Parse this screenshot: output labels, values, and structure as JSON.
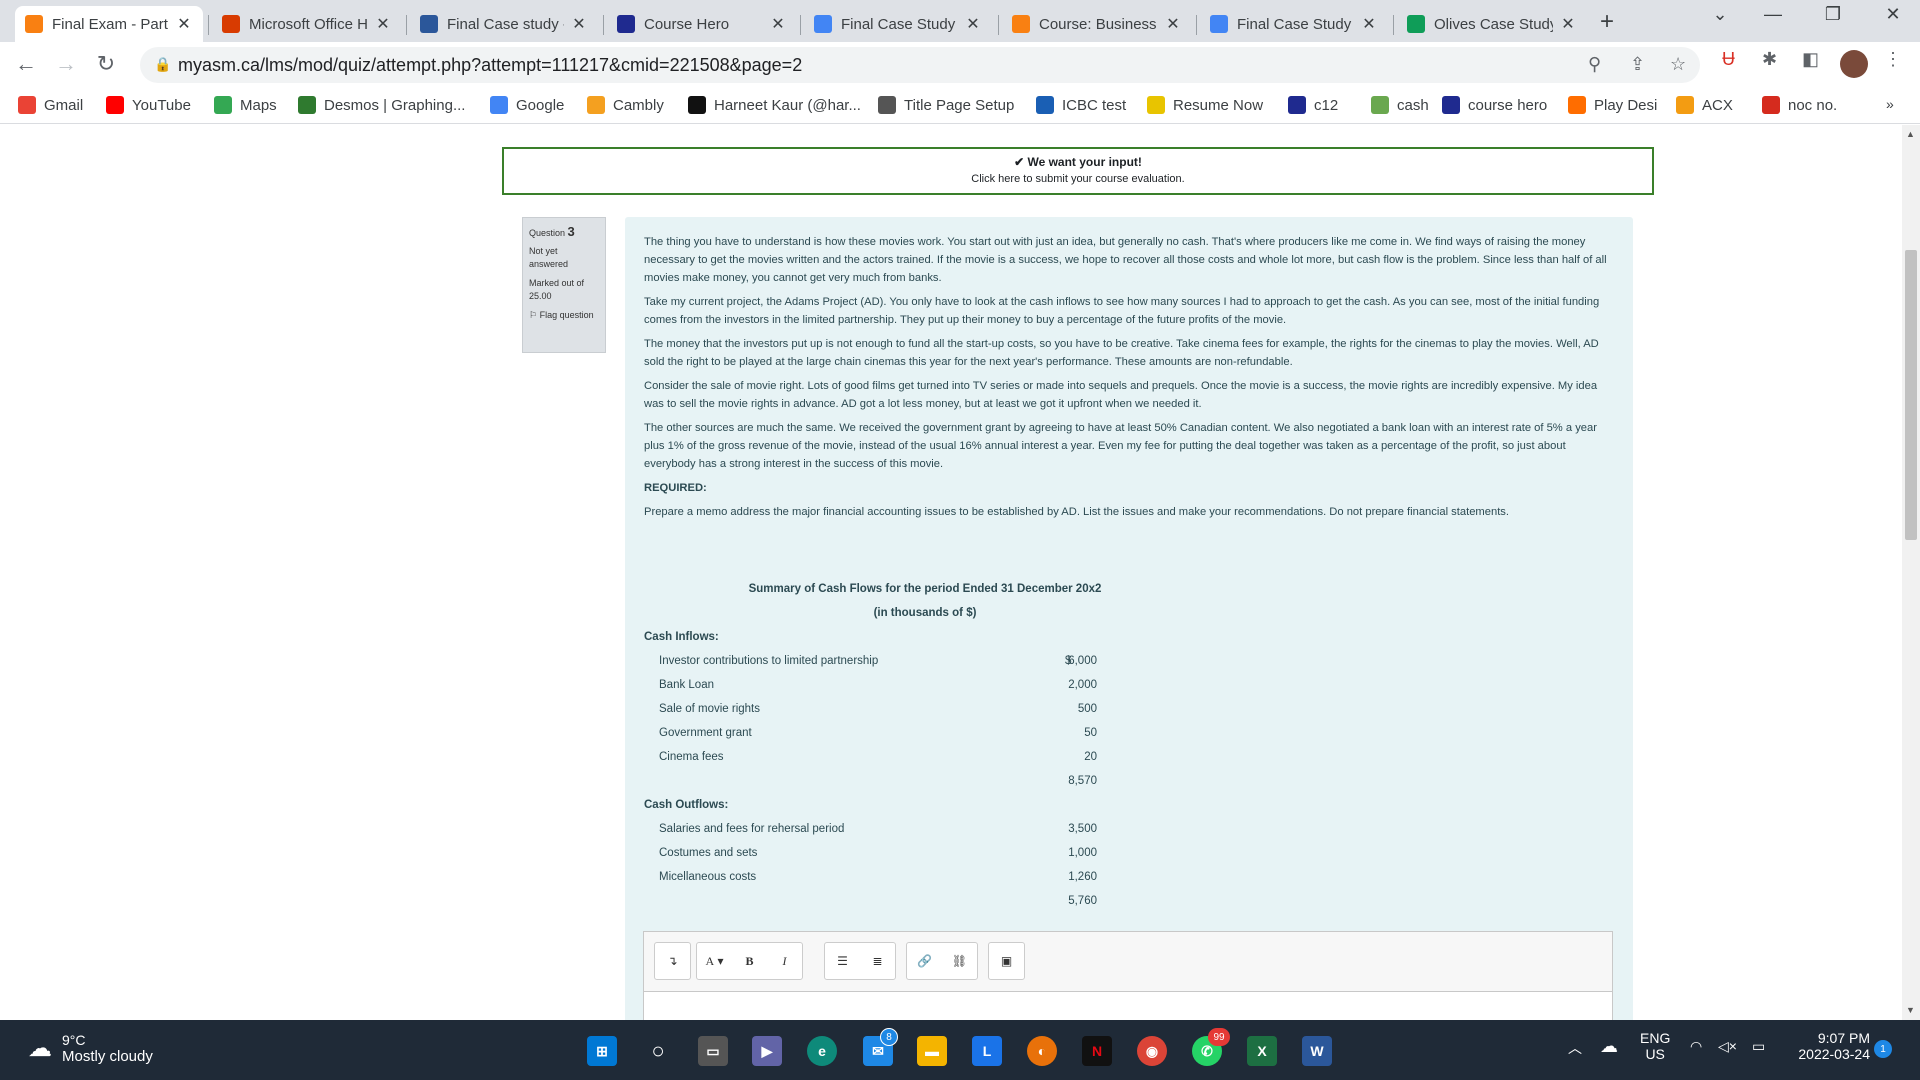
{
  "browser": {
    "tabs": [
      {
        "label": "Final Exam - Part",
        "icon": "moodle-icon",
        "color": "#f98012",
        "active": true
      },
      {
        "label": "Microsoft Office H",
        "icon": "office-icon",
        "color": "#d83b01",
        "active": false
      },
      {
        "label": "Final Case study -",
        "icon": "word-icon",
        "color": "#2b579a",
        "active": false
      },
      {
        "label": "Course Hero",
        "icon": "coursehero-icon",
        "color": "#1f2a8f",
        "active": false
      },
      {
        "label": "Final Case Study -",
        "icon": "docs-icon",
        "color": "#4285f4",
        "active": false
      },
      {
        "label": "Course: Business",
        "icon": "moodle-icon",
        "color": "#f98012",
        "active": false
      },
      {
        "label": "Final Case Study -",
        "icon": "docs-icon",
        "color": "#4285f4",
        "active": false
      },
      {
        "label": "Olives Case Study",
        "icon": "sheets-icon",
        "color": "#0f9d58",
        "active": false
      }
    ],
    "url": "myasm.ca/lms/mod/quiz/attempt.php?attempt=111217&cmid=221508&page=2",
    "bookmarks": [
      {
        "label": "Gmail",
        "icon": "gmail-icon",
        "color": "#ea4335"
      },
      {
        "label": "YouTube",
        "icon": "youtube-icon",
        "color": "#ff0000"
      },
      {
        "label": "Maps",
        "icon": "maps-icon",
        "color": "#34a853"
      },
      {
        "label": "Desmos | Graphing...",
        "icon": "desmos-icon",
        "color": "#2f7a2f"
      },
      {
        "label": "Google",
        "icon": "google-icon",
        "color": "#4285f4"
      },
      {
        "label": "Cambly",
        "icon": "cambly-icon",
        "color": "#f4a020"
      },
      {
        "label": "Harneet Kaur (@har...",
        "icon": "tiktok-icon",
        "color": "#111111"
      },
      {
        "label": "Title Page Setup",
        "icon": "link-icon",
        "color": "#555555"
      },
      {
        "label": "ICBC test",
        "icon": "shield-icon",
        "color": "#1a5fb4"
      },
      {
        "label": "Resume Now",
        "icon": "resume-icon",
        "color": "#e8c400"
      },
      {
        "label": "c12",
        "icon": "coursehero-icon",
        "color": "#1f2a8f"
      },
      {
        "label": "cash",
        "icon": "cash-icon",
        "color": "#6aa84f"
      },
      {
        "label": "course hero",
        "icon": "coursehero-icon",
        "color": "#1f2a8f"
      },
      {
        "label": "Play Desi",
        "icon": "play-icon",
        "color": "#ff6d00"
      },
      {
        "label": "ACX",
        "icon": "acx-icon",
        "color": "#f39c12"
      },
      {
        "label": "noc no.",
        "icon": "maple-leaf-icon",
        "color": "#d52b1e"
      }
    ]
  },
  "banner": {
    "title": "We want your input!",
    "subtitle": "Click here to submit your course evaluation."
  },
  "question": {
    "label": "Question",
    "number": "3",
    "status": "Not yet answered",
    "marked": "Marked out of 25.00",
    "flag": "Flag question",
    "paragraphs": [
      "The thing you have to understand is how these movies work. You start out with just an idea, but generally no cash. That's where producers like me come in. We find ways of raising the money necessary to get the movies written and the actors trained.  If the movie is a success, we hope to recover all those costs and whole lot more, but cash flow is the problem. Since less than half of all movies make money, you cannot get very much from banks.",
      "Take my current project, the Adams Project (AD). You only have to look at the cash inflows to see how many sources I had to approach to get the cash. As you can see, most of the initial funding comes from the investors in the limited partnership. They put up their money to buy a percentage of the future profits of the movie.",
      "The money that the investors put up is not enough to fund all the start-up costs, so you have to be creative. Take cinema fees for example, the rights for the cinemas to play the movies. Well, AD sold the right to be played at the large chain cinemas this year for the next year's performance. These amounts are non-refundable.",
      "Consider the sale of movie right. Lots of good films get turned into TV series or made into sequels and prequels.  Once the movie is a success, the movie rights are incredibly expensive.  My idea was to sell the movie rights in advance. AD got a lot less money, but at least we got it upfront when we needed it.",
      "The other sources are much the same. We received the government grant by agreeing to have at least 50% Canadian content. We also negotiated a bank loan with an interest rate of 5% a year plus 1% of the gross revenue of the movie, instead of the usual 16% annual interest a year. Even my fee for putting the deal together was taken as a percentage of the profit, so just about everybody has a strong interest in the success of this movie."
    ],
    "required_label": "REQUIRED:",
    "required_text": "Prepare a memo address the major financial accounting issues to be established by AD. List the issues and make your recommendations. Do not prepare financial statements."
  },
  "cashflow": {
    "title": "Summary of Cash Flows for the period Ended 31 December 20x2",
    "subtitle": "(in thousands of $)",
    "currency": "$",
    "inflows_label": "Cash Inflows:",
    "inflows": [
      {
        "label": "Investor contributions to limited partnership",
        "value": "6,000"
      },
      {
        "label": "Bank Loan",
        "value": "2,000"
      },
      {
        "label": "Sale of movie rights",
        "value": "500"
      },
      {
        "label": "Government grant",
        "value": "50"
      },
      {
        "label": "Cinema fees",
        "value": "20"
      }
    ],
    "inflows_total": "8,570",
    "outflows_label": "Cash Outflows:",
    "outflows": [
      {
        "label": "Salaries and fees for rehersal period",
        "value": "3,500"
      },
      {
        "label": "Costumes and sets",
        "value": "1,000"
      },
      {
        "label": "Micellaneous costs",
        "value": "1,260"
      }
    ],
    "outflows_total": "5,760"
  },
  "editor": {
    "buttons": [
      "expand-icon",
      "font-color-icon",
      "bold-icon",
      "italic-icon",
      "bullet-list-icon",
      "numbered-list-icon",
      "link-icon",
      "unlink-icon",
      "image-icon"
    ],
    "font_label": "A",
    "bold_label": "B",
    "italic_label": "I"
  },
  "taskbar": {
    "temperature": "9°C",
    "weather": "Mostly cloudy",
    "language": "ENG",
    "region": "US",
    "time": "9:07 PM",
    "date": "2022-03-24",
    "notification_count": "1",
    "mail_badge": "8",
    "whatsapp_badge": "99"
  }
}
